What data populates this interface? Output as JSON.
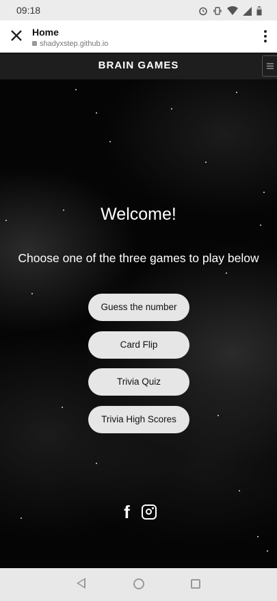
{
  "status_bar": {
    "time": "09:18",
    "icons": [
      "alarm-icon",
      "vibrate-icon",
      "wifi-icon",
      "signal-icon",
      "battery-icon"
    ]
  },
  "browser": {
    "close_icon": "close-icon",
    "title": "Home",
    "url": "shadyxstep.github.io",
    "menu_icon": "more-vert-icon"
  },
  "navbar": {
    "brand": "BRAIN GAMES",
    "toggle_icon": "menu-icon"
  },
  "main": {
    "welcome": "Welcome!",
    "subtitle": "Choose one of the three games to play below",
    "buttons": [
      {
        "label": "Guess the number"
      },
      {
        "label": "Card Flip"
      },
      {
        "label": "Trivia Quiz"
      },
      {
        "label": "Trivia High Scores"
      }
    ]
  },
  "social": {
    "facebook_icon": "facebook-icon",
    "instagram_icon": "instagram-icon",
    "facebook_glyph": "f"
  },
  "android_nav": {
    "items": [
      "back-icon",
      "home-icon",
      "recents-icon"
    ]
  },
  "colors": {
    "navbar_bg": "#1e1e1e",
    "button_bg": "#e6e6e6",
    "hero_bg": "#050505"
  }
}
